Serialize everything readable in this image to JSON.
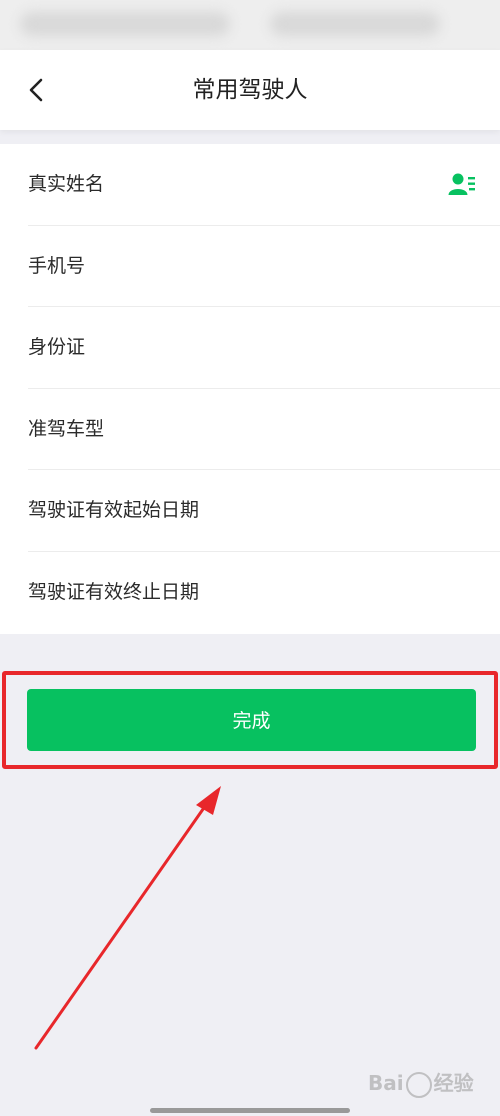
{
  "header": {
    "title": "常用驾驶人"
  },
  "form": {
    "fields": [
      {
        "label": "真实姓名"
      },
      {
        "label": "手机号"
      },
      {
        "label": "身份证"
      },
      {
        "label": "准驾车型"
      },
      {
        "label": "驾驶证有效起始日期"
      },
      {
        "label": "驾驶证有效终止日期"
      }
    ]
  },
  "actions": {
    "done_label": "完成"
  },
  "icons": {
    "back": "chevron-left-icon",
    "contact": "contact-list-icon"
  },
  "colors": {
    "accent": "#07c160",
    "annotation": "#e8272b"
  },
  "watermark": {
    "text": "Bai经验"
  }
}
